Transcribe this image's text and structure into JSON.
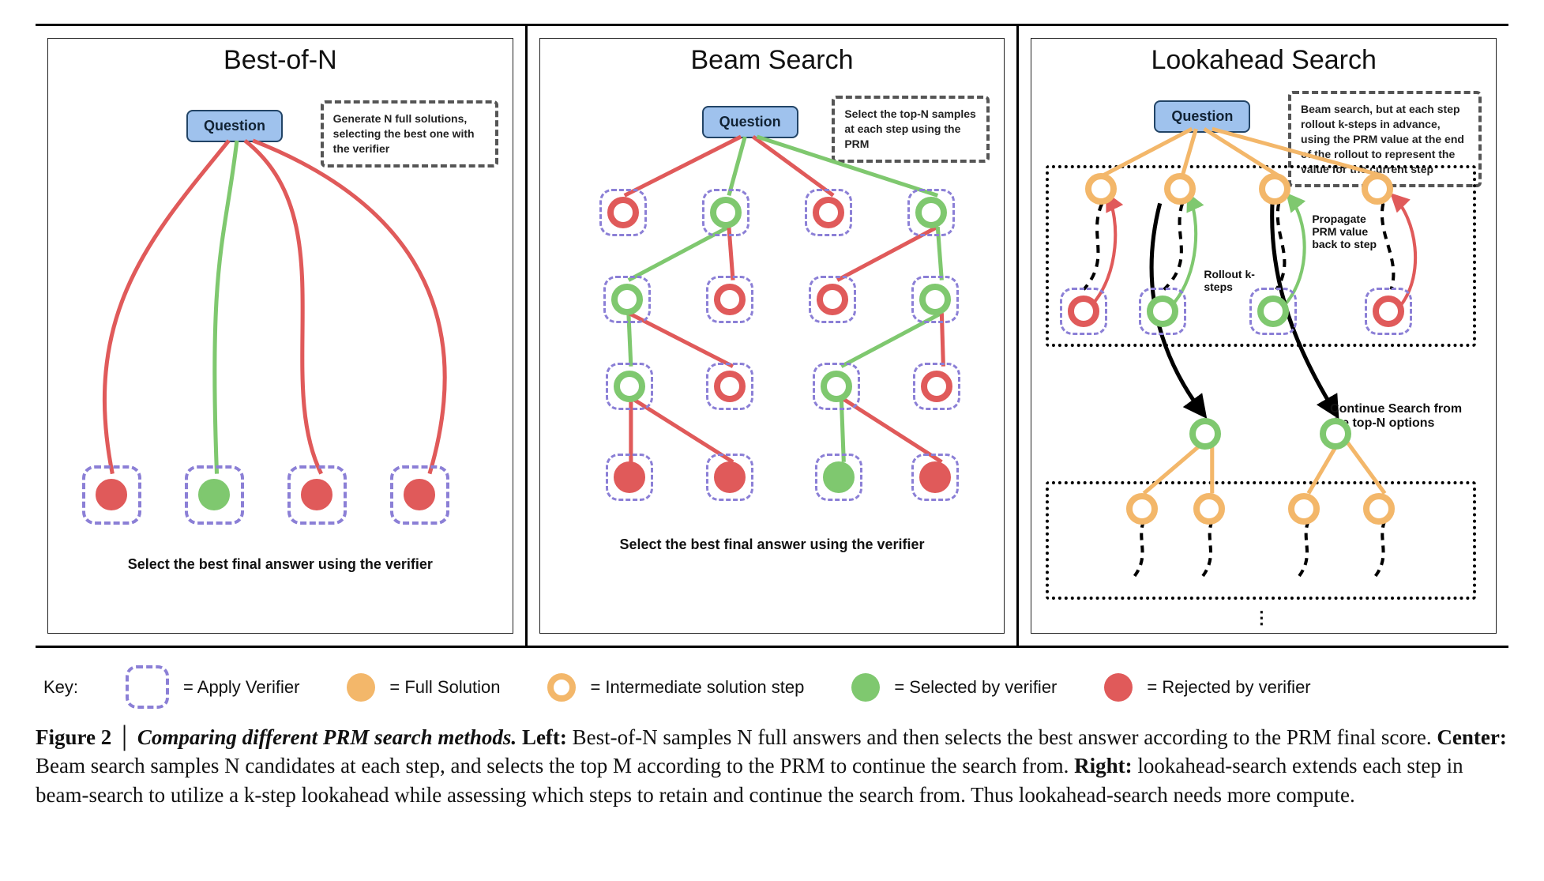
{
  "figure": {
    "label": "Figure 2",
    "title": "Comparing different PRM search methods.",
    "caption_left_label": "Left:",
    "caption_left": " Best-of-N samples N full answers and then selects the best answer according to the PRM final score. ",
    "caption_center_label": "Center:",
    "caption_center": " Beam search samples N candidates at each step, and selects the top M according to the PRM to continue the search from. ",
    "caption_right_label": "Right:",
    "caption_right": " lookahead-search extends each step in beam-search to utilize a k-step lookahead while assessing which steps to retain and continue the search from. Thus lookahead-search needs more compute."
  },
  "panels": {
    "best_of_n": {
      "title": "Best-of-N",
      "question": "Question",
      "note": "Generate N full solutions, selecting the best one with the verifier",
      "caption": "Select the best final answer using the verifier"
    },
    "beam": {
      "title": "Beam Search",
      "question": "Question",
      "note": "Select the top-N samples at each step using the PRM",
      "caption": "Select the best final answer using the verifier"
    },
    "lookahead": {
      "title": "Lookahead Search",
      "question": "Question",
      "note": "Beam search, but at each step rollout k-steps in advance, using the PRM value at the end of the rollout to represent the value for the current step",
      "ann_rollout": "Rollout k-steps",
      "ann_propagate": "Propagate PRM value back to step",
      "ann_continue": "Continue Search from the top-N options",
      "ellipsis": "⋮"
    }
  },
  "key": {
    "label": "Key:",
    "verifier": "= Apply Verifier",
    "full": "= Full Solution",
    "intermediate": "= Intermediate solution step",
    "selected": "= Selected by verifier",
    "rejected": "= Rejected by verifier"
  }
}
